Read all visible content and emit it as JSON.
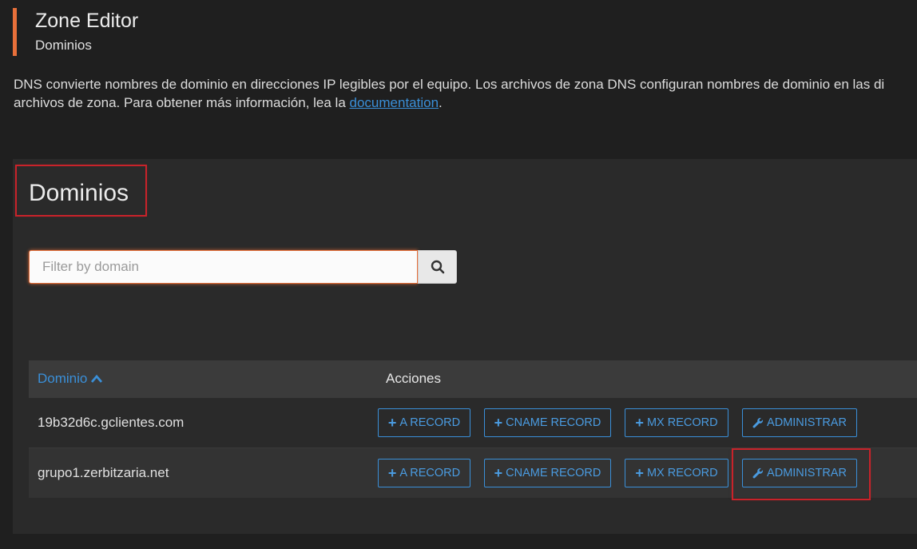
{
  "header": {
    "title": "Zone Editor",
    "subtitle": "Dominios"
  },
  "intro": {
    "text_line1": "DNS convierte nombres de dominio en direcciones IP legibles por el equipo. Los archivos de zona DNS configuran nombres de dominio en las di",
    "text_line2_before": "archivos de zona. Para obtener más información, lea la ",
    "link": "documentation",
    "text_line2_after": "."
  },
  "panel": {
    "heading": "Dominios"
  },
  "search": {
    "placeholder": "Filter by domain",
    "button_icon": "search-icon"
  },
  "table": {
    "columns": [
      "Dominio",
      "Acciones"
    ],
    "sort_icon": "chevron-up-icon",
    "rows": [
      {
        "domain": "19b32d6c.gclientes.com",
        "actions": [
          "A RECORD",
          "CNAME RECORD",
          "MX RECORD",
          "ADMINISTRAR"
        ]
      },
      {
        "domain": "grupo1.zerbitzaria.net",
        "actions": [
          "A RECORD",
          "CNAME RECORD",
          "MX RECORD",
          "ADMINISTRAR"
        ]
      }
    ]
  },
  "colors": {
    "accent": "#e8703a",
    "link": "#3a8fd8",
    "highlight": "#c8232a",
    "background": "#1f1f1f",
    "panel": "#2a2a2a"
  }
}
